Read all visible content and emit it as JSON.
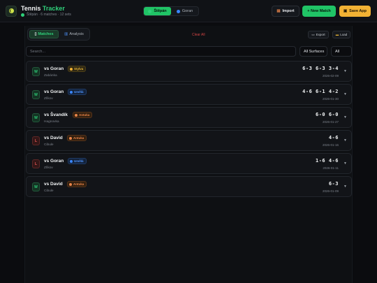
{
  "app": {
    "title_main": "Tennis",
    "title_accent": "Tracker",
    "subtitle": "Štěpán · 6 matches · 12 sets",
    "logo_icon": "tennis-ball-icon"
  },
  "header": {
    "players": [
      {
        "label": "Štěpán",
        "active": true
      },
      {
        "label": "Goran",
        "active": false
      }
    ],
    "import_label": "Import",
    "new_match_label": "+ New Match",
    "save_label": "Save App"
  },
  "toolbar": {
    "tabs": [
      {
        "label": "Matches",
        "icon": "clipboard-icon",
        "active": true
      },
      {
        "label": "Analysis",
        "icon": "bar-chart-icon",
        "active": false
      }
    ],
    "clear_all_label": "Clear All",
    "export_label": "Export",
    "load_label": "Load"
  },
  "filters": {
    "search_placeholder": "Search...",
    "surface_value": "All Surfaces",
    "result_value": "All"
  },
  "colors": {
    "accent_green": "#2fd07a",
    "loss_red": "#ef5a5a",
    "grass": "#e6b436",
    "hard": "#4e94ff",
    "clay": "#e9844a"
  },
  "matches": [
    {
      "result": "W",
      "opponent": "vs Goran",
      "surface": "Stylva",
      "surface_type": "grass",
      "location": "Zabánka",
      "score": "6-3  6-3  3-4",
      "date": "2026-02-09"
    },
    {
      "result": "W",
      "opponent": "vs Goran",
      "surface": "Umělá",
      "surface_type": "hard",
      "location": "Zlíkov",
      "score": "4-6  6-1  4-2",
      "date": "2026-01-30"
    },
    {
      "result": "W",
      "opponent": "vs Švandík",
      "surface": "Antuka",
      "surface_type": "clay",
      "location": "Hagnovka",
      "score": "6-0  6-0",
      "date": "2026-01-27"
    },
    {
      "result": "L",
      "opponent": "vs David",
      "surface": "Antuka",
      "surface_type": "clay",
      "location": "Cibule",
      "score": "4-6",
      "date": "2026-01-16"
    },
    {
      "result": "L",
      "opponent": "vs Goran",
      "surface": "Umělá",
      "surface_type": "hard",
      "location": "Zlíkov",
      "score": "1-6  4-6",
      "date": "2026-01-11"
    },
    {
      "result": "W",
      "opponent": "vs David",
      "surface": "Antuka",
      "surface_type": "clay",
      "location": "Cibule",
      "score": "6-3",
      "date": "2026-01-09"
    }
  ]
}
